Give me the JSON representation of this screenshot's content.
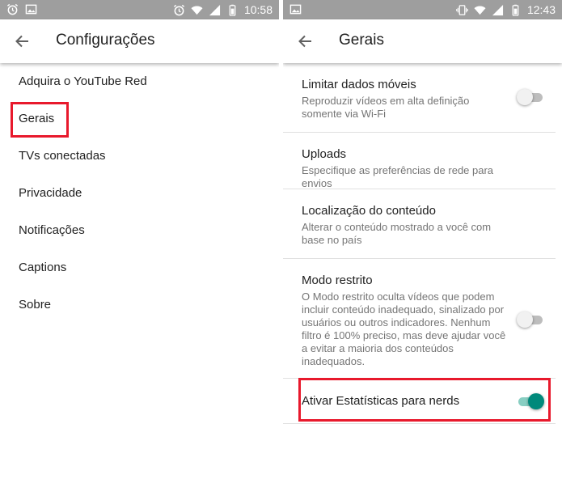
{
  "left_screen": {
    "status_bar": {
      "time": "10:58"
    },
    "toolbar": {
      "title": "Configurações"
    },
    "menu_items": [
      "Adquira o YouTube Red",
      "Gerais",
      "TVs conectadas",
      "Privacidade",
      "Notificações",
      "Captions",
      "Sobre"
    ],
    "highlighted_item": "Gerais"
  },
  "right_screen": {
    "status_bar": {
      "time": "12:43"
    },
    "toolbar": {
      "title": "Gerais"
    },
    "settings": [
      {
        "title": "Limitar dados móveis",
        "subtitle": "Reproduzir vídeos em alta definição somente via Wi-Fi",
        "toggle": false
      },
      {
        "title": "Uploads",
        "subtitle": "Especifique as preferências de rede para envios"
      },
      {
        "title": "Localização do conteúdo",
        "subtitle": "Alterar o conteúdo mostrado a você com base no país"
      },
      {
        "title": "Modo restrito",
        "subtitle": "O Modo restrito oculta vídeos que podem incluir conteúdo inadequado, sinalizado por usuários ou outros indicadores. Nenhum filtro é 100% preciso, mas deve ajudar você a evitar a maioria dos conteúdos inadequados.",
        "toggle": false
      },
      {
        "title": "Ativar Estatísticas para nerds",
        "toggle": true
      }
    ]
  },
  "colors": {
    "status_bar": "#9e9e9e",
    "highlight_box": "#e8192c",
    "toggle_on": "#00897b",
    "toggle_on_track": "#88cec2",
    "toggle_off_track": "#bdbdbd"
  },
  "icons": [
    "alarm-icon",
    "image-icon",
    "wifi-icon",
    "signal-icon",
    "battery-icon",
    "vibrate-icon",
    "back-arrow-icon"
  ]
}
